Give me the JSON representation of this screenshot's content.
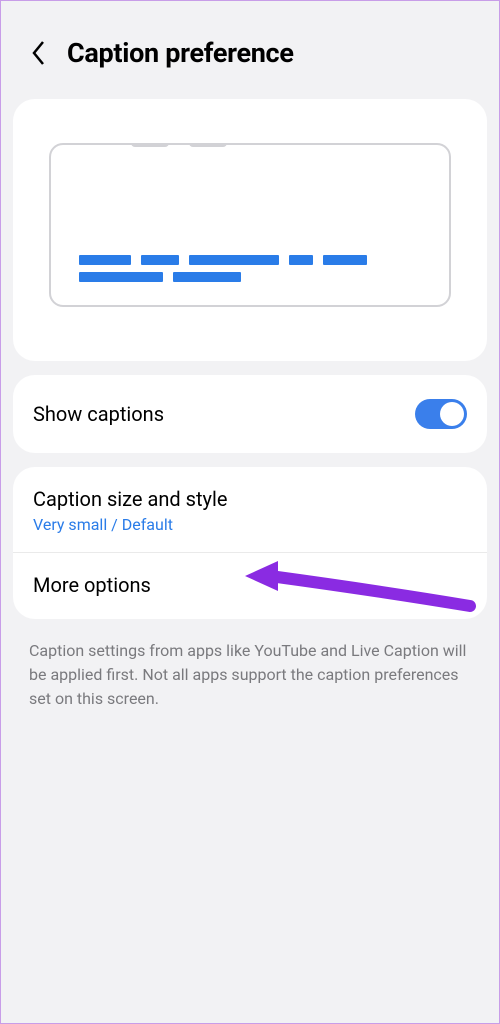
{
  "header": {
    "title": "Caption preference"
  },
  "showCaptions": {
    "label": "Show captions",
    "enabled": true
  },
  "captionStyle": {
    "title": "Caption size and style",
    "subtitle": "Very small / Default"
  },
  "moreOptions": {
    "title": "More options"
  },
  "footer": {
    "text": "Caption settings from apps like YouTube and Live Caption will be applied first. Not all apps support the caption preferences set on this screen."
  }
}
